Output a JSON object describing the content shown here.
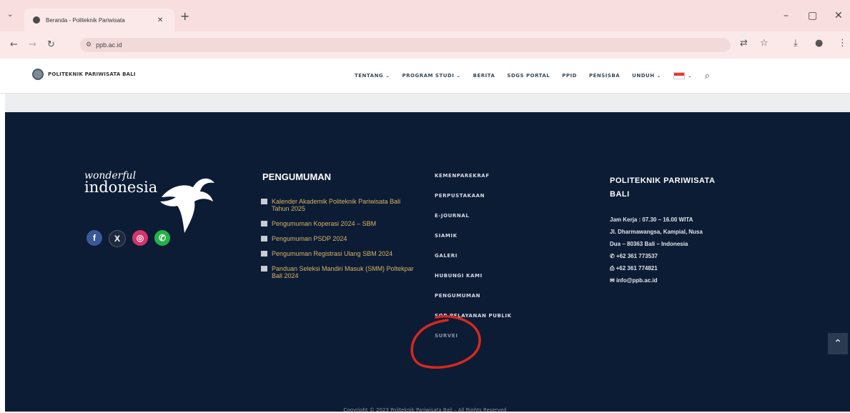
{
  "browser": {
    "tab_title": "Beranda - Politeknik Pariwisata",
    "url": "ppb.ac.id"
  },
  "site": {
    "logo_text": "POLITEKNIK PARIWISATA BALI",
    "nav": [
      "TENTANG ⌄",
      "PROGRAM STUDI ⌄",
      "BERITA",
      "SDGS PORTAL",
      "PPID",
      "PENSISBA",
      "UNDUH ⌄"
    ],
    "flag_chevron": "⌄"
  },
  "footer": {
    "brand_line1": "wonderful",
    "brand_line2": "indonesia",
    "socials": [
      "f",
      "X",
      "◎",
      "✆"
    ],
    "announcements": {
      "heading": "PENGUMUMAN",
      "items": [
        "Kalender Akademik Politeknik Pariwisata Bali Tahun 2025",
        "Pengumuman Koperasi 2024 – SBM",
        "Pengumuman PSDP 2024",
        "Pengumuman Registrasi Ulang SBM 2024",
        "Panduan Seleksi Mandiri Masuk (SMM) Poltekpar Bali 2024"
      ]
    },
    "links": [
      "KEMENPAREKRAF",
      "PERPUSTAKAAN",
      "E-JOURNAL",
      "SIAMIK",
      "GALERI",
      "HUBUNGI KAMI",
      "PENGUMUMAN",
      "SOP PELAYANAN PUBLIK",
      "SURVEI"
    ],
    "contact": {
      "heading_line1": "POLITEKNIK PARIWISATA",
      "heading_line2": "BALI",
      "hours": "Jam Kerja : 07.30 – 16.00 WITA",
      "address_line1": "Jl. Dharmawangsa, Kampial, Nusa",
      "address_line2": "Dua – 80363 Bali – Indonesia",
      "phone": "+62 361 773537",
      "fax": "+62 361 774821",
      "email": "info@ppb.ac.id"
    },
    "copyright": "Copyright © 2023 Politeknik Pariwisata Bali – All Rights Reserved"
  }
}
